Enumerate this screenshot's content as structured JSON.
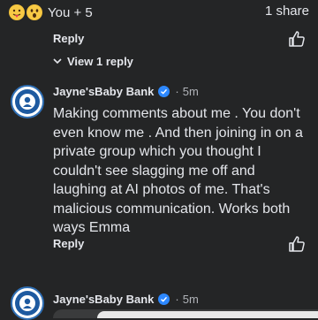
{
  "post": {
    "reaction_summary": "You + 5",
    "share_count": "1 share",
    "reaction_icons": [
      "care-emoji-icon",
      "wow-emoji-icon"
    ]
  },
  "top_comment": {
    "reply_label": "Reply"
  },
  "replies_toggle": {
    "label": "View 1 reply"
  },
  "comment1": {
    "author": "Jayne'sBaby Bank",
    "time": "5m",
    "text": "Making comments about me . You don't even know me . And then joining  in on a private group which you thought I couldn't see slagging me off and laughing at AI photos of me. That's malicious communication.  Works both ways Emma",
    "reply_label": "Reply"
  },
  "comment2": {
    "author": "Jayne'sBaby Bank",
    "time": "5m"
  },
  "colors": {
    "background": "#242526",
    "text": "#e4e6eb",
    "muted": "#b0b3b8",
    "verified": "#2d88ff"
  }
}
